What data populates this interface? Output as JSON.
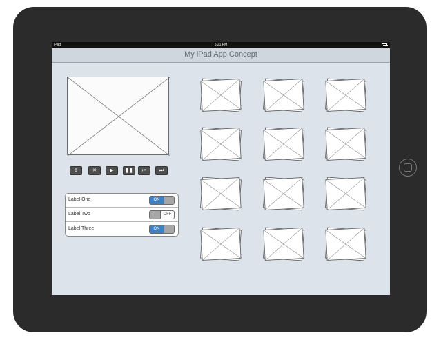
{
  "status_bar": {
    "carrier": "iPad",
    "time": "5:21 PM",
    "battery_icon": "battery-icon"
  },
  "nav_bar": {
    "title": "My iPad App Concept"
  },
  "video": {
    "placeholder_icon": "image-placeholder-icon"
  },
  "controls": [
    {
      "name": "share-button",
      "icon": "share-icon",
      "glyph": "⇪"
    },
    {
      "name": "close-button",
      "icon": "close-icon",
      "glyph": "✕"
    },
    {
      "name": "play-button",
      "icon": "play-icon",
      "glyph": "▶"
    },
    {
      "name": "pause-button",
      "icon": "pause-icon",
      "glyph": "❚❚"
    },
    {
      "name": "rewind-button",
      "icon": "rewind-icon",
      "glyph": "⏮"
    },
    {
      "name": "fast-forward-button",
      "icon": "fast-forward-icon",
      "glyph": "⏭"
    }
  ],
  "settings": [
    {
      "label": "Label One",
      "state": "ON",
      "on": true
    },
    {
      "label": "Label Two",
      "state": "OFF",
      "on": false
    },
    {
      "label": "Label Three",
      "state": "ON",
      "on": true
    }
  ],
  "gallery": {
    "rows": 4,
    "columns": 3,
    "item_icon": "image-placeholder-icon"
  },
  "colors": {
    "device": "#2b2b2b",
    "screen": "#dce3ea",
    "toggle_on": "#3f7fc4"
  }
}
